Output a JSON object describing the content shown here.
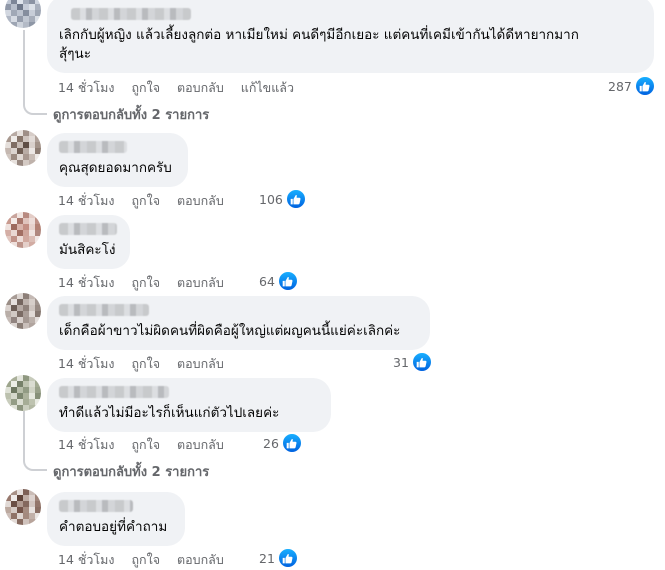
{
  "colors": {
    "bubble": "#f0f2f5",
    "meta_text": "#65676b",
    "like_blue": "#0866ff",
    "thread_line": "#ced0d4"
  },
  "comments": [
    {
      "text": "เลิกกับผู้หญิง แล้วเลี้ยงลูกต่อ หาเมียใหม่ คนดีๆมีอีกเยอะ แต่คนที่เคมีเข้ากันได้ดีหายากมาก\nสุ้ๆนะ",
      "time": "14 ชั่วโมง",
      "like": "ถูกใจ",
      "reply": "ตอบกลับ",
      "edited": "แก้ไขแล้ว",
      "reactions": "287",
      "view_replies": "ดูการตอบกลับทั้ง 2 รายการ"
    },
    {
      "text": "คุณสุดยอดมากครับ",
      "time": "14 ชั่วโมง",
      "like": "ถูกใจ",
      "reply": "ตอบกลับ",
      "reactions": "106"
    },
    {
      "text": "มันสิคะโง่",
      "time": "14 ชั่วโมง",
      "like": "ถูกใจ",
      "reply": "ตอบกลับ",
      "reactions": "64"
    },
    {
      "text": "เด็กคือผ้าขาวไม่ผิดคนที่ผิดคือผู้ใหญ่แต่ผญคนนี้แย่ค่ะเลิกค่ะ",
      "time": "14 ชั่วโมง",
      "like": "ถูกใจ",
      "reply": "ตอบกลับ",
      "reactions": "31"
    },
    {
      "text": "ทำดีแล้วไม่มีอะไรก็เห็นแก่ตัวไปเลยค่ะ",
      "time": "14 ชั่วโมง",
      "like": "ถูกใจ",
      "reply": "ตอบกลับ",
      "reactions": "26",
      "view_replies": "ดูการตอบกลับทั้ง 2 รายการ"
    },
    {
      "text": "คำตอบอยู่ที่คำถาม",
      "time": "14 ชั่วโมง",
      "like": "ถูกใจ",
      "reply": "ตอบกลับ",
      "reactions": "21"
    }
  ]
}
